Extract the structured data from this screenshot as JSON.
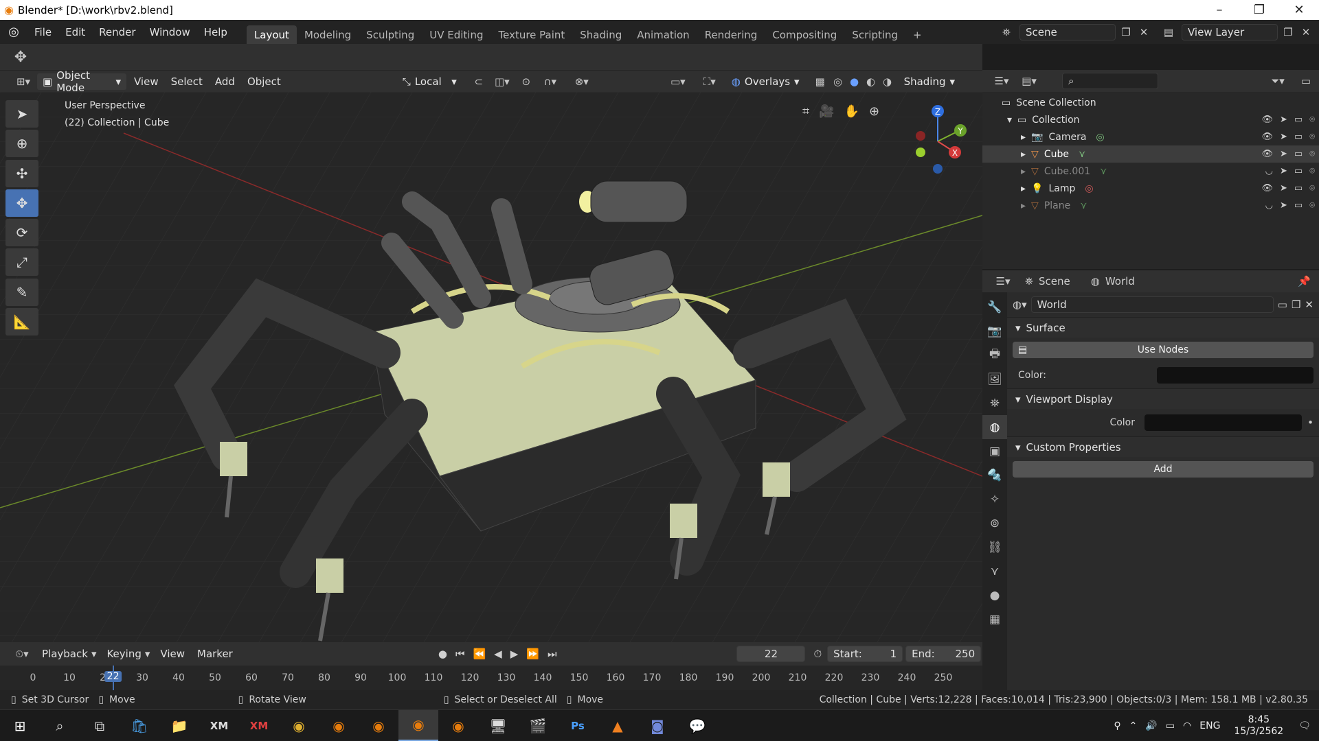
{
  "window": {
    "title": "Blender* [D:\\work\\rbv2.blend]"
  },
  "menu": {
    "items": [
      "File",
      "Edit",
      "Render",
      "Window",
      "Help"
    ]
  },
  "workspaces": [
    "Layout",
    "Modeling",
    "Sculpting",
    "UV Editing",
    "Texture Paint",
    "Shading",
    "Animation",
    "Rendering",
    "Compositing",
    "Scripting",
    "+"
  ],
  "scene": {
    "name": "Scene",
    "view_layer": "View Layer"
  },
  "header3d": {
    "mode": "Object Mode",
    "menus": [
      "View",
      "Select",
      "Add",
      "Object"
    ],
    "transform": "Local",
    "overlays": "Overlays",
    "shading": "Shading"
  },
  "viewport": {
    "perspective": "User Perspective",
    "collection_info": "(22) Collection | Cube"
  },
  "gizmo": {
    "z": "Z",
    "y": "Y",
    "x": "X"
  },
  "outliner": {
    "root": "Scene Collection",
    "collection": "Collection",
    "items": [
      {
        "name": "Camera",
        "icon": "camera-icon"
      },
      {
        "name": "Cube",
        "icon": "mesh-icon"
      },
      {
        "name": "Cube.001",
        "icon": "mesh-icon"
      },
      {
        "name": "Lamp",
        "icon": "lamp-icon"
      },
      {
        "name": "Plane",
        "icon": "mesh-icon"
      }
    ]
  },
  "properties": {
    "context": {
      "scene": "Scene",
      "world": "World"
    },
    "world_name": "World",
    "surface": {
      "title": "Surface",
      "use_nodes": "Use Nodes",
      "color_label": "Color:"
    },
    "viewport_display": {
      "title": "Viewport Display",
      "color_label": "Color"
    },
    "custom_props": {
      "title": "Custom Properties",
      "add": "Add"
    }
  },
  "timeline": {
    "menus": [
      "Playback",
      "Keying",
      "View",
      "Marker"
    ],
    "current_frame": "22",
    "start_label": "Start:",
    "start": "1",
    "end_label": "End:",
    "end": "250",
    "ticks": [
      "0",
      "10",
      "20",
      "30",
      "40",
      "50",
      "60",
      "70",
      "80",
      "90",
      "100",
      "110",
      "120",
      "130",
      "140",
      "150",
      "160",
      "170",
      "180",
      "190",
      "200",
      "210",
      "220",
      "230",
      "240",
      "250"
    ],
    "playhead": "22"
  },
  "status": {
    "left": [
      "Set 3D Cursor",
      "Move",
      "Rotate View",
      "Select or Deselect All",
      "Move"
    ],
    "stats": "Collection | Cube | Verts:12,228 | Faces:10,014 | Tris:23,900 | Objects:0/3 | Mem: 158.1 MB | v2.80.35"
  },
  "taskbar": {
    "lang": "ENG",
    "time": "8:45",
    "date": "15/3/2562"
  }
}
